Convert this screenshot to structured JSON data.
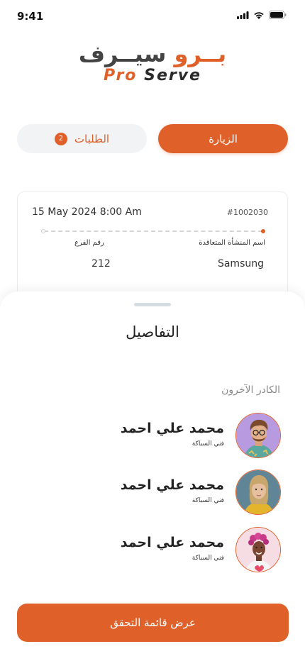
{
  "status_bar": {
    "time": "9:41",
    "icons": [
      "signal-icon",
      "wifi-icon",
      "battery-icon"
    ]
  },
  "logo": {
    "arabic_part_1": "سيــرف",
    "arabic_part_2": "بــرو",
    "english_part_1": "Pro",
    "english_part_2": "Serve"
  },
  "tabs": {
    "visit_label": "الزيارة",
    "requests_label": "الطلبات",
    "requests_badge": "2"
  },
  "card": {
    "date": "15 May 2024 8:00 Am",
    "id": "#1002030",
    "company_label": "اسم المنشأة المتعاقدة",
    "company_value": "Samsung",
    "branch_label": "رقم الفرع",
    "branch_value": "212"
  },
  "sheet": {
    "title": "التفاصيل",
    "section_label": "الكادر الآخرون",
    "members": [
      {
        "name": "محمد علي احمد",
        "role": "فني السباكة"
      },
      {
        "name": "محمد علي احمد",
        "role": "فني السباكة"
      },
      {
        "name": "محمد علي احمد",
        "role": "فني السباكة"
      }
    ]
  },
  "cta": {
    "label": "عرض قائمة التحقق"
  },
  "colors": {
    "accent": "#e0602a",
    "tab_inactive_bg": "#f1f3f4",
    "text": "#222222"
  }
}
